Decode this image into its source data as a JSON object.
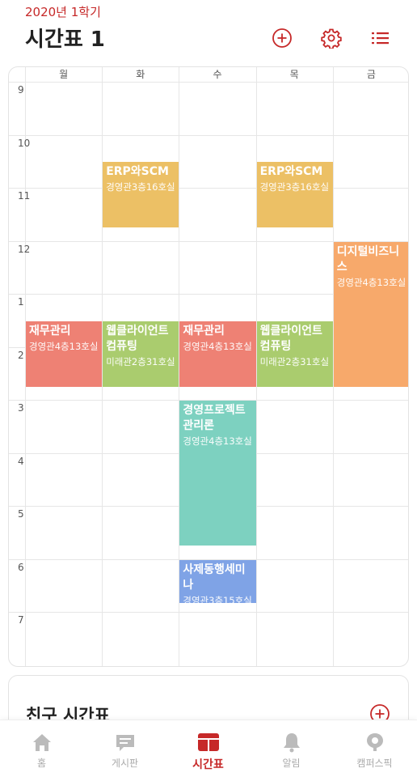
{
  "header": {
    "semester": "2020년 1학기",
    "title": "시간표 1",
    "accent_color": "#c62828"
  },
  "icons": {
    "add": "plus-circle-icon",
    "settings": "gear-icon",
    "list": "list-icon"
  },
  "timetable": {
    "days": [
      "월",
      "화",
      "수",
      "목",
      "금"
    ],
    "hours": [
      "9",
      "10",
      "11",
      "12",
      "1",
      "2",
      "3",
      "4",
      "5",
      "6",
      "7"
    ],
    "courses": [
      {
        "name": "ERP와SCM",
        "room": "경영관3층16호실",
        "day": "화",
        "start": "10:30",
        "end": "11:45",
        "color": "#ecc065"
      },
      {
        "name": "ERP와SCM",
        "room": "경영관3층16호실",
        "day": "목",
        "start": "10:30",
        "end": "11:45",
        "color": "#ecc065"
      },
      {
        "name": "디지털비즈니스",
        "room": "경영관4층13호실",
        "day": "금",
        "start": "12:00",
        "end": "14:45",
        "color": "#f7a96b"
      },
      {
        "name": "재무관리",
        "room": "경영관4층13호실",
        "day": "월",
        "start": "13:30",
        "end": "14:45",
        "color": "#ee8174"
      },
      {
        "name": "웹클라이언트컴퓨팅",
        "room": "미래관2층31호실",
        "day": "화",
        "start": "13:30",
        "end": "14:45",
        "color": "#aacc6e"
      },
      {
        "name": "재무관리",
        "room": "경영관4층13호실",
        "day": "수",
        "start": "13:30",
        "end": "14:45",
        "color": "#ee8174"
      },
      {
        "name": "웹클라이언트컴퓨팅",
        "room": "미래관2층31호실",
        "day": "목",
        "start": "13:30",
        "end": "14:45",
        "color": "#aacc6e"
      },
      {
        "name": "경영프로젝트관리론",
        "room": "경영관4층13호실",
        "day": "수",
        "start": "15:00",
        "end": "17:45",
        "color": "#7dd1c0"
      },
      {
        "name": "사제동행세미나",
        "room": "경영관3층15호실",
        "day": "수",
        "start": "18:00",
        "end": "18:50",
        "color": "#7fa3e6"
      }
    ]
  },
  "friends": {
    "title": "친구 시간표",
    "add_icon": "plus-circle-icon"
  },
  "nav": {
    "items": [
      {
        "label": "홈",
        "icon": "home-icon",
        "active": false
      },
      {
        "label": "게시판",
        "icon": "board-icon",
        "active": false
      },
      {
        "label": "시간표",
        "icon": "timetable-icon",
        "active": true
      },
      {
        "label": "알림",
        "icon": "bell-icon",
        "active": false
      },
      {
        "label": "캠퍼스픽",
        "icon": "campuspick-icon",
        "active": false
      }
    ]
  }
}
